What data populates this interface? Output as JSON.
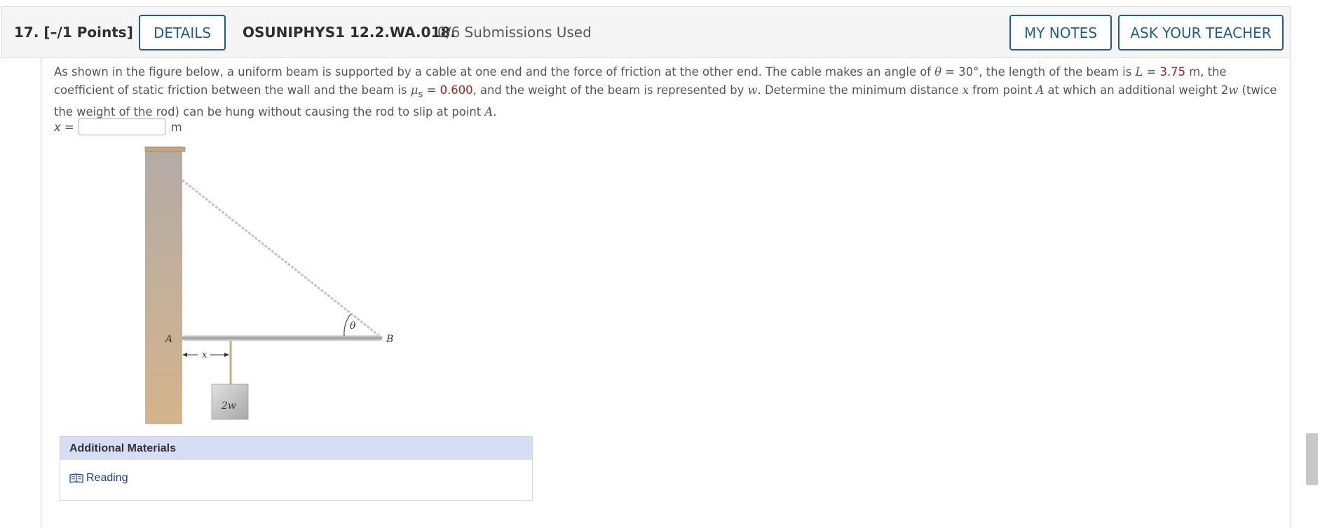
{
  "header": {
    "question_number": "17.",
    "points": "[–/1 Points]",
    "details_label": "DETAILS",
    "question_id": "OSUNIPHYS1 12.2.WA.018.",
    "submissions": "0/6 Submissions Used",
    "my_notes_label": "MY NOTES",
    "ask_teacher_label": "ASK YOUR TEACHER"
  },
  "problem": {
    "t1": "As shown in the figure below, a uniform beam is supported by a cable at one end and the force of friction at the other end. The cable makes an angle of ",
    "theta": "θ",
    "t2": " = 30°, the length of the beam is ",
    "L": "L",
    "t3": " = ",
    "L_value": "3.75",
    "t4": " m, the coefficient of static friction between the wall and the beam is ",
    "mu": "μ",
    "mu_sub": "s",
    "t5": " = ",
    "mu_value": "0.600",
    "t6": ", and the weight of the beam is represented by ",
    "w": "w",
    "t7": ". Determine the minimum distance ",
    "x": "x",
    "t8": " from point ",
    "A": "A",
    "t9": " at which an additional weight 2",
    "w2": "w",
    "t10": " (twice the weight of the rod) can be hung without causing the rod to slip at point ",
    "A2": "A",
    "t11": "."
  },
  "answer": {
    "label": "x =",
    "value": "",
    "unit": "m"
  },
  "figure": {
    "label_A": "A",
    "label_B": "B",
    "label_theta": "θ",
    "label_x": "x",
    "label_weight": "2w"
  },
  "additional_materials": {
    "title": "Additional Materials",
    "reading_label": "Reading"
  },
  "colors": {
    "value_red": "#a3261d",
    "button_blue": "#1f5f85",
    "materials_header": "#d6def6",
    "link_blue": "#1d3f8a"
  }
}
